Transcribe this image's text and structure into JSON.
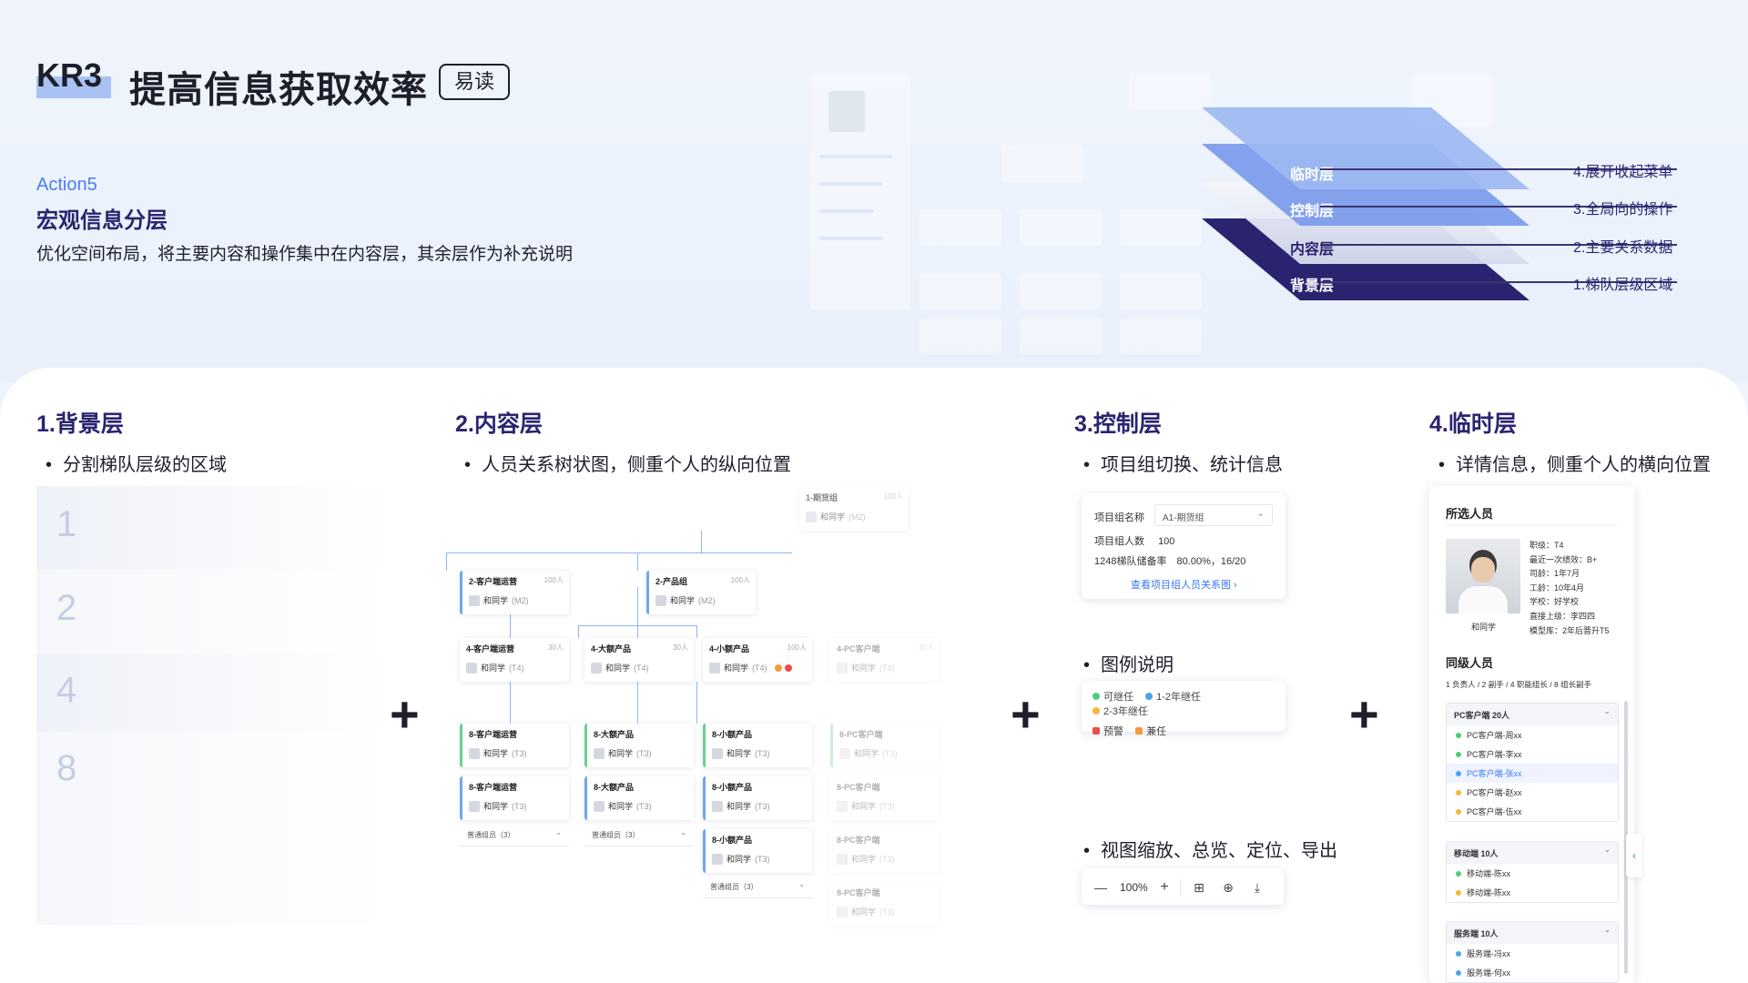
{
  "header": {
    "kr": "KR3",
    "title": "提高信息获取效率",
    "badge": "易读",
    "action_no": "Action5",
    "action_title": "宏观信息分层",
    "action_desc": "优化空间布局，将主要内容和操作集中在内容层，其余层作为补充说明"
  },
  "layers": [
    {
      "label": "临时层",
      "note": "4.展开收起菜单",
      "color": "#9db8f2"
    },
    {
      "label": "控制层",
      "note": "3.全局向的操作",
      "color": "#7d9ceb"
    },
    {
      "label": "内容层",
      "note": "2.主要关系数据",
      "color": "#e9ecf6"
    },
    {
      "label": "背景层",
      "note": "1.梯队层级区域",
      "color": "#2a2470"
    }
  ],
  "sections": [
    {
      "title": "1.背景层",
      "bullet": "分割梯队层级的区域"
    },
    {
      "title": "2.内容层",
      "bullet": "人员关系树状图，侧重个人的纵向位置"
    },
    {
      "title": "3.控制层",
      "bullet": "项目组切换、统计信息"
    },
    {
      "title": "4.临时层",
      "bullet": "详情信息，侧重个人的横向位置"
    }
  ],
  "plus": "+",
  "background_rows": [
    "1",
    "2",
    "4",
    "8"
  ],
  "org": {
    "root": {
      "title": "1-期货组",
      "count": "100人",
      "person": "和同学",
      "level": "(M2)"
    },
    "l2": [
      {
        "title": "2-客户端运营",
        "count": "100人",
        "person": "和同学",
        "level": "(M2)"
      },
      {
        "title": "2-产品组",
        "count": "100人",
        "person": "和同学",
        "level": "(M2)"
      }
    ],
    "l4": [
      {
        "title": "4-客户端运营",
        "count": "30人",
        "person": "和同学",
        "level": "(T4)"
      },
      {
        "title": "4-大额产品",
        "count": "30人",
        "person": "和同学",
        "level": "(T4)"
      },
      {
        "title": "4-小额产品",
        "count": "100人",
        "person": "和同学",
        "level": "(T4)"
      },
      {
        "title": "4-PC客户端",
        "count": "30人",
        "person": "和同学",
        "level": "(T4)"
      }
    ],
    "l8_cols": [
      {
        "title": "8-客户端运营",
        "person": "和同学",
        "level": "(T3)",
        "rows": 2
      },
      {
        "title": "8-大额产品",
        "person": "和同学",
        "level": "(T3)",
        "rows": 2
      },
      {
        "title": "8-小额产品",
        "person": "和同学",
        "level": "(T3)",
        "rows": 3
      },
      {
        "title": "8-PC客户端",
        "person": "和同学",
        "level": "(T3)",
        "rows": 4
      }
    ],
    "ordinary": "普通组员（3）"
  },
  "control": {
    "group_label": "项目组名称",
    "group_value": "A1-期货组",
    "count_label": "项目组人数",
    "count_value": "100",
    "reserve_label": "1248梯队储备率",
    "reserve_value": "80.00%，16/20",
    "link": "查看项目组人员关系图 ›",
    "legend_title": "图例说明",
    "legend": [
      {
        "label": "可继任",
        "color": "#4ccf7a"
      },
      {
        "label": "1-2年继任",
        "color": "#4aa3f0"
      },
      {
        "label": "2-3年继任",
        "color": "#f3b93a"
      },
      {
        "label": "预警",
        "color": "#f04b4b"
      },
      {
        "label": "兼任",
        "color": "#f59a3a"
      }
    ],
    "view_title": "视图缩放、总览、定位、导出",
    "zoom": "100%"
  },
  "temp": {
    "selected_title": "所选人员",
    "name": "和同学",
    "info": [
      "职级：T4",
      "最近一次绩效：B+",
      "司龄：1年7月",
      "工龄：10年4月",
      "学校：好学校",
      "直接上级：李四四",
      "模型库：2年后晋升T5"
    ],
    "peers_title": "同级人员",
    "peers_summary": "1 负责人 / 2 副手 / 4 职能组长 / 8 组长副手",
    "groups": [
      {
        "name": "PC客户端  20人",
        "items": [
          {
            "name": "PC客户端-周xx",
            "color": "#4ccf7a"
          },
          {
            "name": "PC客户端-李xx",
            "color": "#4ccf7a"
          },
          {
            "name": "PC客户端-张xx",
            "color": "#4aa3f0",
            "selected": true
          },
          {
            "name": "PC客户端-赵xx",
            "color": "#f3b93a"
          },
          {
            "name": "PC客户端-伍xx",
            "color": "#f3b93a"
          }
        ]
      },
      {
        "name": "移动端  10人",
        "items": [
          {
            "name": "移动端-陈xx",
            "color": "#4ccf7a"
          },
          {
            "name": "移动端-陈xx",
            "color": "#f3b93a"
          }
        ]
      },
      {
        "name": "服务端  10人",
        "items": [
          {
            "name": "服务端-冯xx",
            "color": "#4aa3f0"
          },
          {
            "name": "服务端-何xx",
            "color": "#4aa3f0"
          }
        ]
      }
    ]
  }
}
